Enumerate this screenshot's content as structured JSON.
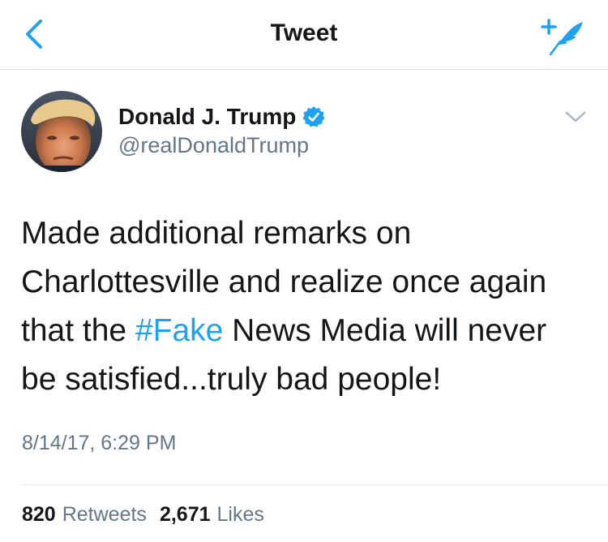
{
  "nav": {
    "title": "Tweet",
    "back_icon": "chevron-left-icon",
    "compose_icon": "compose-feather-icon",
    "accent": "#1da1f2"
  },
  "author": {
    "display_name": "Donald J. Trump",
    "handle": "@realDonaldTrump",
    "verified": true,
    "avatar_icon": "profile-photo"
  },
  "tweet": {
    "text_before": "Made additional remarks on Charlottesville and realize once again that the ",
    "hashtag": "#Fake",
    "text_after": " News Media will never be satisfied...truly bad people!",
    "timestamp": "8/14/17, 6:29 PM"
  },
  "stats": {
    "retweets_count": "820",
    "retweets_label": "Retweets",
    "likes_count": "2,671",
    "likes_label": "Likes"
  },
  "colors": {
    "text": "#14171a",
    "secondary": "#657786",
    "link": "#1da1f2",
    "divider": "#e1e8ed"
  }
}
